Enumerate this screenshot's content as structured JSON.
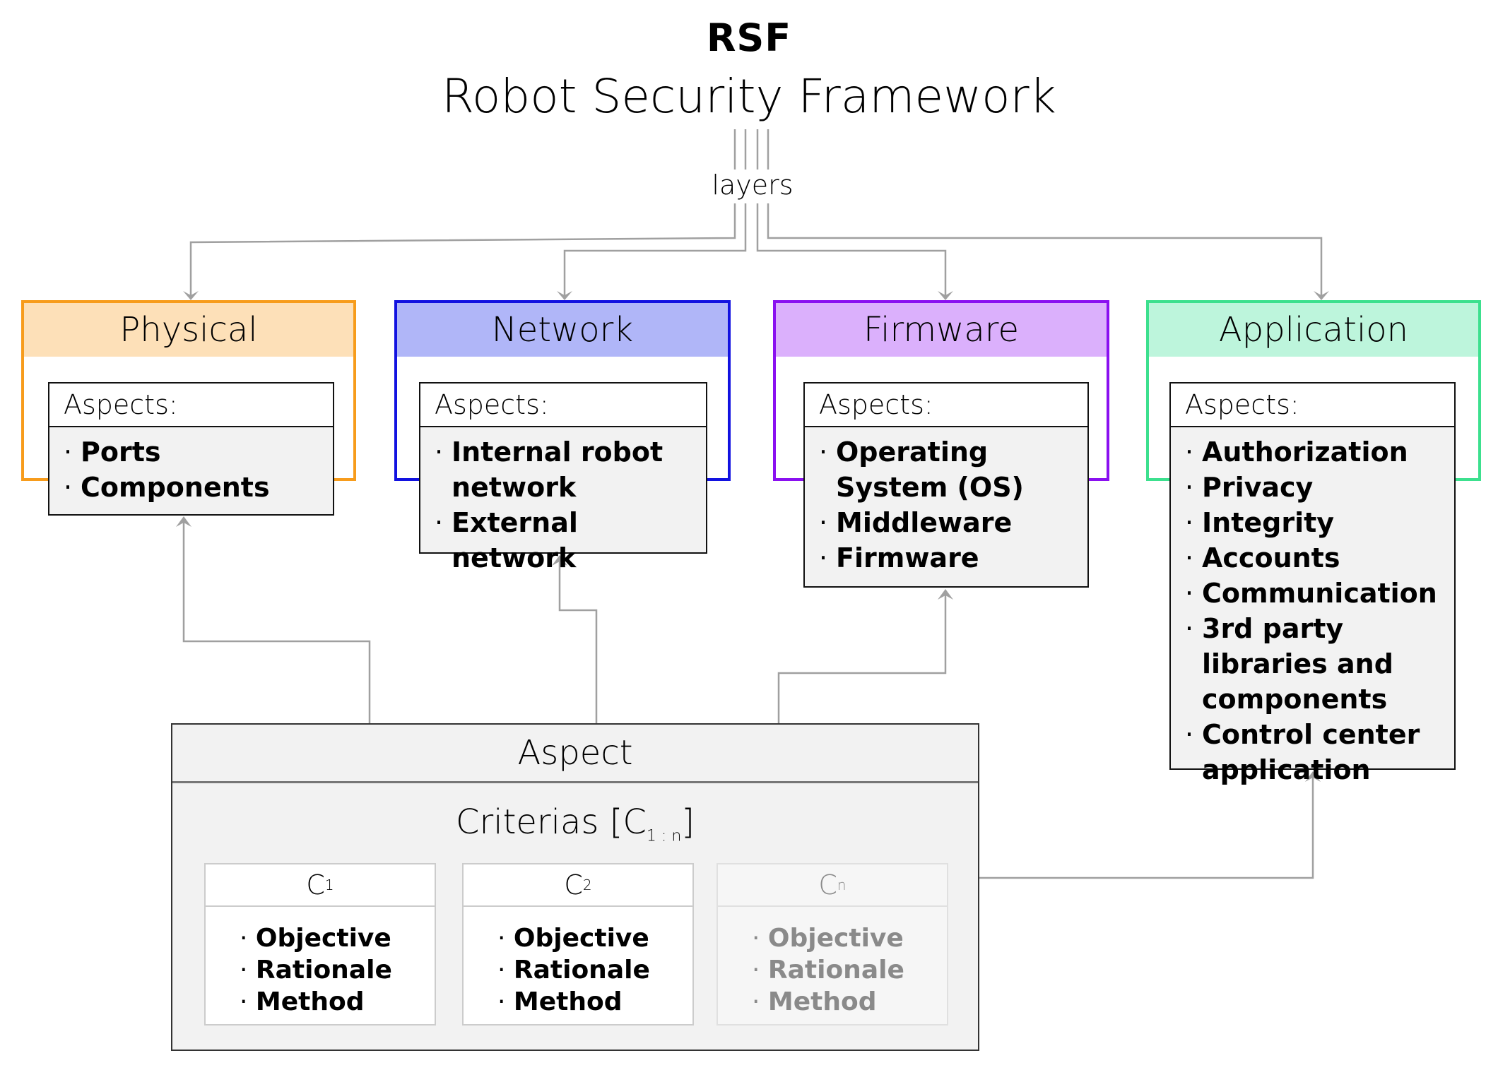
{
  "title": {
    "abbr": "RSF",
    "full": "Robot Security Framework"
  },
  "layers_label": "layers",
  "colors": {
    "physical_border": "#f79c1c",
    "physical_header": "#fde0b8",
    "network_border": "#1212e0",
    "network_header": "#b0b6f8",
    "firmware_border": "#8a10f0",
    "firmware_header": "#dbb0fc",
    "application_border": "#3ce08e",
    "application_header": "#bdf5dc",
    "connector": "#a0a0a0"
  },
  "layers": [
    {
      "name": "Physical",
      "aspects_label": "Aspects:",
      "aspects": [
        "Ports",
        "Components"
      ]
    },
    {
      "name": "Network",
      "aspects_label": "Aspects:",
      "aspects": [
        "Internal robot network",
        "External network"
      ]
    },
    {
      "name": "Firmware",
      "aspects_label": "Aspects:",
      "aspects": [
        "Operating System (OS)",
        "Middleware",
        "Firmware"
      ]
    },
    {
      "name": "Application",
      "aspects_label": "Aspects:",
      "aspects": [
        "Authorization",
        "Privacy",
        "Integrity",
        "Accounts",
        "Communication",
        "3rd party libraries and components",
        "Control center application"
      ]
    }
  ],
  "aspect": {
    "title": "Aspect",
    "criterias_label": "Criterias [",
    "criterias_base": "C",
    "criterias_sub": "1 : n",
    "criterias_close": "]",
    "criteria": [
      {
        "base": "C",
        "sub": "1",
        "items": [
          "Objective",
          "Rationale",
          "Method"
        ]
      },
      {
        "base": "C",
        "sub": "2",
        "items": [
          "Objective",
          "Rationale",
          "Method"
        ]
      },
      {
        "base": "C",
        "sub": "n",
        "items": [
          "Objective",
          "Rationale",
          "Method"
        ]
      }
    ]
  }
}
